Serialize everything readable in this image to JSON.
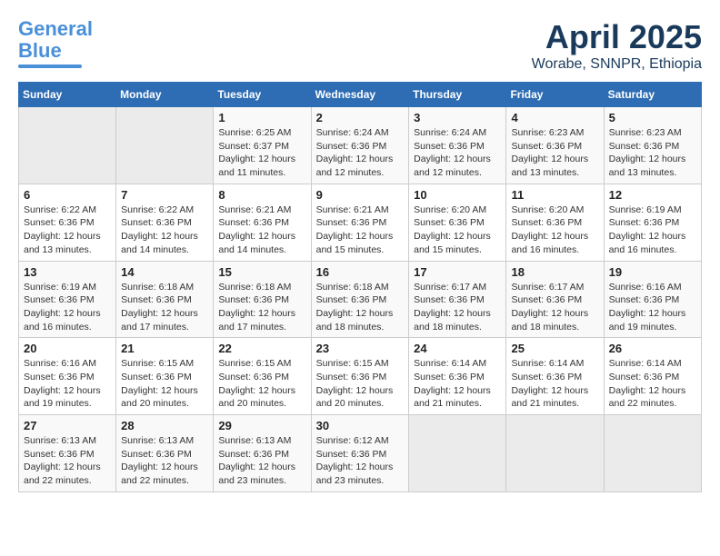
{
  "logo": {
    "line1": "General",
    "line2": "Blue"
  },
  "header": {
    "month_year": "April 2025",
    "location": "Worabe, SNNPR, Ethiopia"
  },
  "weekdays": [
    "Sunday",
    "Monday",
    "Tuesday",
    "Wednesday",
    "Thursday",
    "Friday",
    "Saturday"
  ],
  "weeks": [
    [
      {
        "day": "",
        "empty": true
      },
      {
        "day": "",
        "empty": true
      },
      {
        "day": "1",
        "sunrise": "6:25 AM",
        "sunset": "6:37 PM",
        "daylight": "12 hours and 11 minutes."
      },
      {
        "day": "2",
        "sunrise": "6:24 AM",
        "sunset": "6:36 PM",
        "daylight": "12 hours and 12 minutes."
      },
      {
        "day": "3",
        "sunrise": "6:24 AM",
        "sunset": "6:36 PM",
        "daylight": "12 hours and 12 minutes."
      },
      {
        "day": "4",
        "sunrise": "6:23 AM",
        "sunset": "6:36 PM",
        "daylight": "12 hours and 13 minutes."
      },
      {
        "day": "5",
        "sunrise": "6:23 AM",
        "sunset": "6:36 PM",
        "daylight": "12 hours and 13 minutes."
      }
    ],
    [
      {
        "day": "6",
        "sunrise": "6:22 AM",
        "sunset": "6:36 PM",
        "daylight": "12 hours and 13 minutes."
      },
      {
        "day": "7",
        "sunrise": "6:22 AM",
        "sunset": "6:36 PM",
        "daylight": "12 hours and 14 minutes."
      },
      {
        "day": "8",
        "sunrise": "6:21 AM",
        "sunset": "6:36 PM",
        "daylight": "12 hours and 14 minutes."
      },
      {
        "day": "9",
        "sunrise": "6:21 AM",
        "sunset": "6:36 PM",
        "daylight": "12 hours and 15 minutes."
      },
      {
        "day": "10",
        "sunrise": "6:20 AM",
        "sunset": "6:36 PM",
        "daylight": "12 hours and 15 minutes."
      },
      {
        "day": "11",
        "sunrise": "6:20 AM",
        "sunset": "6:36 PM",
        "daylight": "12 hours and 16 minutes."
      },
      {
        "day": "12",
        "sunrise": "6:19 AM",
        "sunset": "6:36 PM",
        "daylight": "12 hours and 16 minutes."
      }
    ],
    [
      {
        "day": "13",
        "sunrise": "6:19 AM",
        "sunset": "6:36 PM",
        "daylight": "12 hours and 16 minutes."
      },
      {
        "day": "14",
        "sunrise": "6:18 AM",
        "sunset": "6:36 PM",
        "daylight": "12 hours and 17 minutes."
      },
      {
        "day": "15",
        "sunrise": "6:18 AM",
        "sunset": "6:36 PM",
        "daylight": "12 hours and 17 minutes."
      },
      {
        "day": "16",
        "sunrise": "6:18 AM",
        "sunset": "6:36 PM",
        "daylight": "12 hours and 18 minutes."
      },
      {
        "day": "17",
        "sunrise": "6:17 AM",
        "sunset": "6:36 PM",
        "daylight": "12 hours and 18 minutes."
      },
      {
        "day": "18",
        "sunrise": "6:17 AM",
        "sunset": "6:36 PM",
        "daylight": "12 hours and 18 minutes."
      },
      {
        "day": "19",
        "sunrise": "6:16 AM",
        "sunset": "6:36 PM",
        "daylight": "12 hours and 19 minutes."
      }
    ],
    [
      {
        "day": "20",
        "sunrise": "6:16 AM",
        "sunset": "6:36 PM",
        "daylight": "12 hours and 19 minutes."
      },
      {
        "day": "21",
        "sunrise": "6:15 AM",
        "sunset": "6:36 PM",
        "daylight": "12 hours and 20 minutes."
      },
      {
        "day": "22",
        "sunrise": "6:15 AM",
        "sunset": "6:36 PM",
        "daylight": "12 hours and 20 minutes."
      },
      {
        "day": "23",
        "sunrise": "6:15 AM",
        "sunset": "6:36 PM",
        "daylight": "12 hours and 20 minutes."
      },
      {
        "day": "24",
        "sunrise": "6:14 AM",
        "sunset": "6:36 PM",
        "daylight": "12 hours and 21 minutes."
      },
      {
        "day": "25",
        "sunrise": "6:14 AM",
        "sunset": "6:36 PM",
        "daylight": "12 hours and 21 minutes."
      },
      {
        "day": "26",
        "sunrise": "6:14 AM",
        "sunset": "6:36 PM",
        "daylight": "12 hours and 22 minutes."
      }
    ],
    [
      {
        "day": "27",
        "sunrise": "6:13 AM",
        "sunset": "6:36 PM",
        "daylight": "12 hours and 22 minutes."
      },
      {
        "day": "28",
        "sunrise": "6:13 AM",
        "sunset": "6:36 PM",
        "daylight": "12 hours and 22 minutes."
      },
      {
        "day": "29",
        "sunrise": "6:13 AM",
        "sunset": "6:36 PM",
        "daylight": "12 hours and 23 minutes."
      },
      {
        "day": "30",
        "sunrise": "6:12 AM",
        "sunset": "6:36 PM",
        "daylight": "12 hours and 23 minutes."
      },
      {
        "day": "",
        "empty": true
      },
      {
        "day": "",
        "empty": true
      },
      {
        "day": "",
        "empty": true
      }
    ]
  ],
  "labels": {
    "sunrise": "Sunrise:",
    "sunset": "Sunset:",
    "daylight": "Daylight:"
  }
}
